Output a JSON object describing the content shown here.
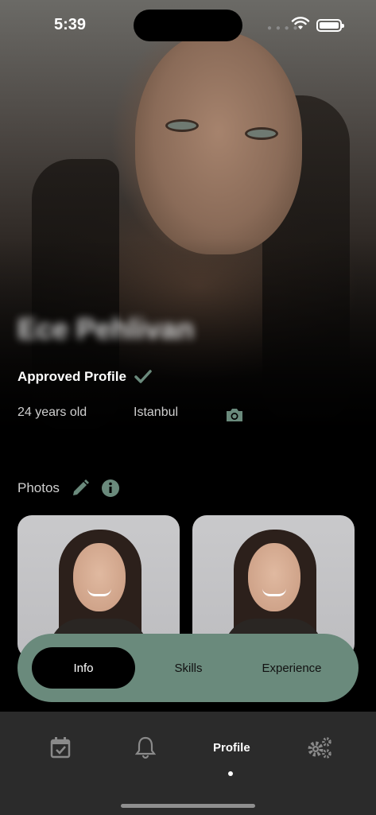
{
  "status_bar": {
    "time": "5:39"
  },
  "profile": {
    "name": "Ece Pehlivan",
    "approved_label": "Approved Profile",
    "age": "24 years old",
    "city": "Istanbul"
  },
  "photos": {
    "label": "Photos",
    "count_visible": 2
  },
  "segments": [
    {
      "label": "Info",
      "active": true
    },
    {
      "label": "Skills",
      "active": false
    },
    {
      "label": "Experience",
      "active": false
    }
  ],
  "bottom_nav": {
    "items": [
      {
        "icon": "calendar-check-icon"
      },
      {
        "icon": "bell-icon"
      },
      {
        "label": "Profile",
        "active": true
      },
      {
        "icon": "gears-icon"
      }
    ]
  },
  "colors": {
    "accent": "#6a8a7c",
    "nav_bg": "#2b2b2b",
    "background": "#000000"
  }
}
